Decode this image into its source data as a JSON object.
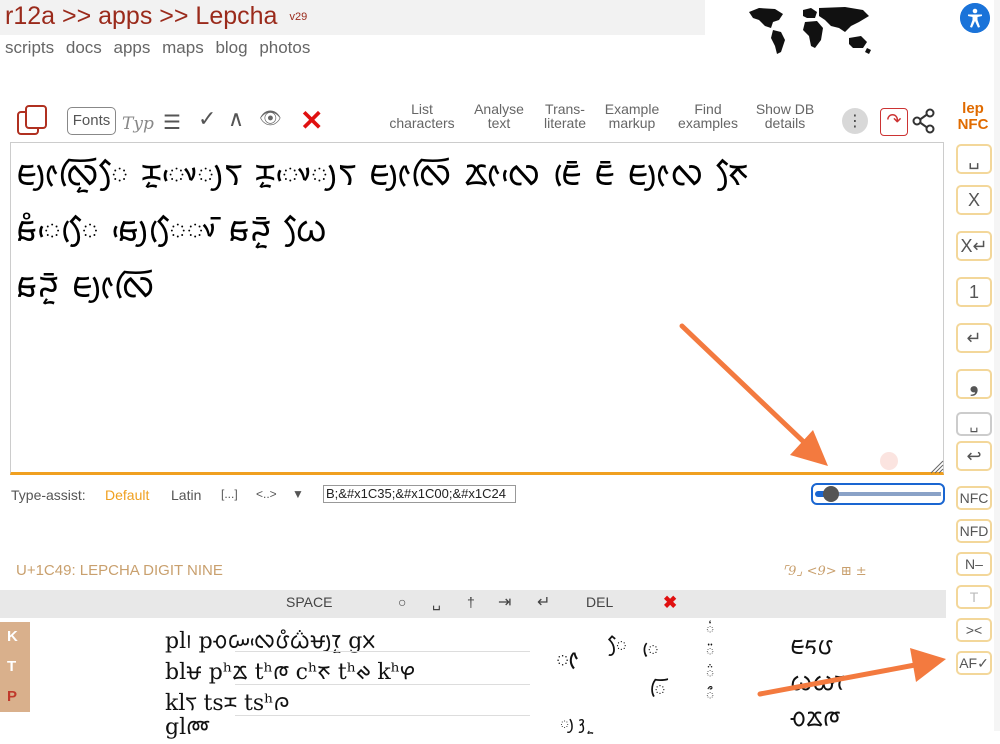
{
  "header": {
    "title": "r12a >> apps >> Lepcha",
    "version": "v29",
    "nav": [
      "scripts",
      "docs",
      "apps",
      "maps",
      "blog",
      "photos"
    ]
  },
  "toolbar": {
    "fonts_label": "Fonts",
    "typ_label": "Typ",
    "links": [
      {
        "line1": "List",
        "line2": "characters"
      },
      {
        "line1": "Analyse",
        "line2": "text"
      },
      {
        "line1": "Trans-",
        "line2": "literate"
      },
      {
        "line1": "Example",
        "line2": "markup"
      },
      {
        "line1": "Find",
        "line2": "examples"
      },
      {
        "line1": "Show DB",
        "line2": "details"
      }
    ],
    "lang_label_1": "lep",
    "lang_label_2": "NFC"
  },
  "editor": {
    "lines": [
      "ᰀᰪᰦᰜᰩᰬᰧ ᰌᰬᰤᰵᰪᰛ ᰌᰬᰤᰵᰪᰛ ᰀᰪᰦᰜᰩ ᰇᰦᰜᰵ ᰀᰨᰳ ᰀᰳ ᰀᰪᰦᰜ ᰉᰧ",
      "ᰑᰱᰵᰧᰨ ᰑᰪᰵᰧᰨᰤᰳ ᰑᰎᰬᰳ ᰃᰧ",
      "ᰑᰎᰬᰳ ᰀᰪᰦᰜᰩ"
    ]
  },
  "type_assist": {
    "label": "Type-assist:",
    "options": [
      "Default",
      "Latin",
      "[...]",
      "<..>"
    ],
    "dropdown": "▼",
    "input_value": "B;&#x1C35;&#x1C00;&#x1C24"
  },
  "slider": {
    "value_fraction": 0.05
  },
  "char_info": {
    "name": "U+1C49: LEPCHA DIGIT NINE",
    "meta": "⌜9⌟ <9> ⊞ ±"
  },
  "keyboard": {
    "keys": [
      "SPACE",
      "○",
      "␣",
      "†",
      "⇥",
      "↵",
      "DEL",
      "✖"
    ],
    "side_letters": [
      "K",
      "T",
      "P"
    ],
    "rows": [
      "pl᰻  pᰆᰠᰜᰵᰂᰱᰃᰯᰝᰪᰅᰬ gᰞ",
      "blᰝ  pʰᰇ  tʰᰈ  cʰᰉ  tʰᰊ  kʰᰋ",
      "klᰛ   tsᰌ   tsʰᰍ",
      "glᰢ"
    ],
    "right_rows": [
      "ᰀᰁᰂ",
      "ᰃᰄᰅ",
      "ᰆᰇᰈ"
    ]
  },
  "side_panel": {
    "buttons": [
      "␣",
      "X",
      "X↵",
      "1",
      "↵",
      "❟",
      "␣",
      "↩",
      "NFC",
      "NFD",
      "N–",
      "T",
      "><",
      "AF✓"
    ]
  },
  "colors": {
    "accent_orange": "#f0a020",
    "title_red": "#9a2a1b",
    "arrow": "#f37a3f",
    "button_border": "#f3d79a"
  }
}
